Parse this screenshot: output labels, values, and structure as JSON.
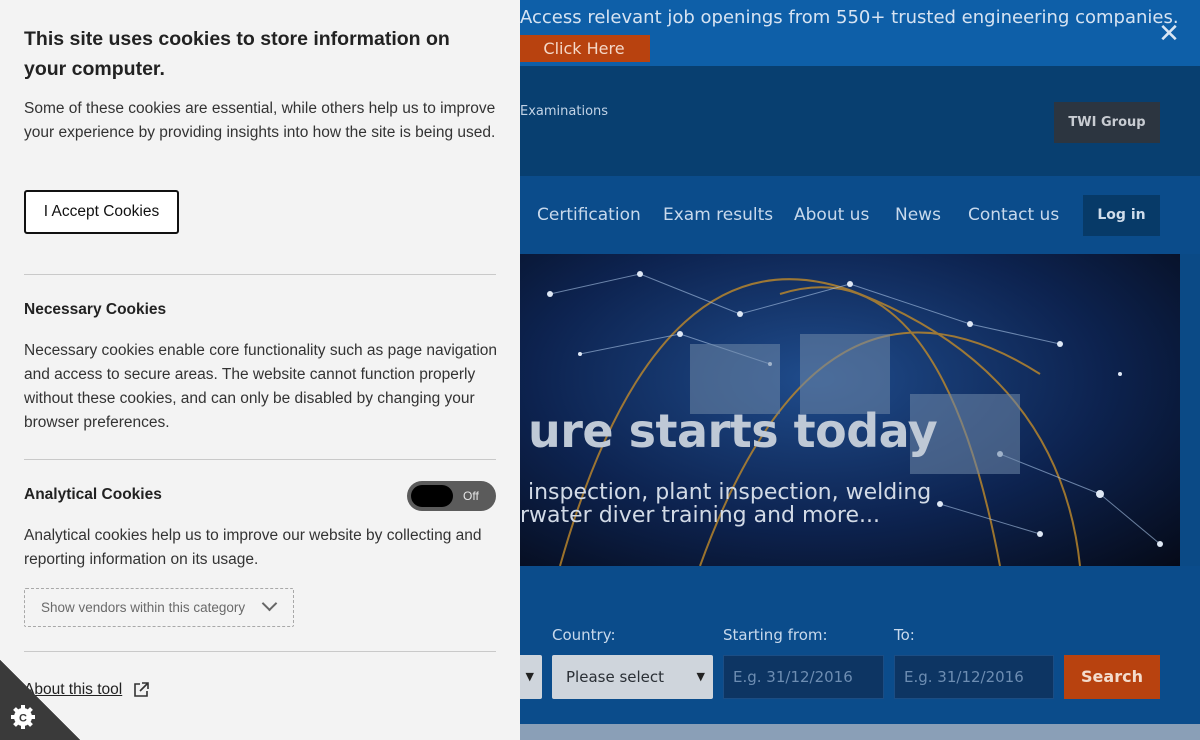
{
  "background_page": {
    "banner": {
      "message": "Access relevant job openings from 550+ trusted engineering companies.",
      "cta_label": "Click Here",
      "close_icon": "close-icon"
    },
    "header": {
      "examinations_link": "Examinations",
      "group_button": "TWI Group"
    },
    "nav": {
      "items": [
        "Certification",
        "Exam results",
        "About us",
        "News",
        "Contact us"
      ],
      "login_label": "Log in"
    },
    "hero": {
      "headline": "ure starts today",
      "sub_line1": "inspection, plant inspection, welding",
      "sub_line2": "rwater diver training and more..."
    },
    "search": {
      "country_label": "Country:",
      "starting_label": "Starting from:",
      "to_label": "To:",
      "country_value": "Please select",
      "start_placeholder": "E.g. 31/12/2016",
      "end_placeholder": "E.g. 31/12/2016",
      "search_label": "Search"
    }
  },
  "cookie_panel": {
    "title": "This site uses cookies to store information on your computer.",
    "intro": "Some of these cookies are essential, while others help us to improve your experience by providing insights into how the site is being used.",
    "accept_label": "I Accept Cookies",
    "necessary": {
      "title": "Necessary Cookies",
      "text": "Necessary cookies enable core functionality such as page navigation and access to secure areas. The website cannot function properly without these cookies, and can only be disabled by changing your browser preferences."
    },
    "analytical": {
      "title": "Analytical Cookies",
      "toggle_state": "Off",
      "text": "Analytical cookies help us to improve our website by collecting and reporting information on its usage.",
      "vendors_label": "Show vendors within this category"
    },
    "about_label": "About this tool"
  },
  "colors": {
    "panel_bg": "#f3f3f3",
    "banner_bg": "#0e5fa8",
    "cta_orange": "#b8420f",
    "nav_bg": "#0b4c8b"
  }
}
